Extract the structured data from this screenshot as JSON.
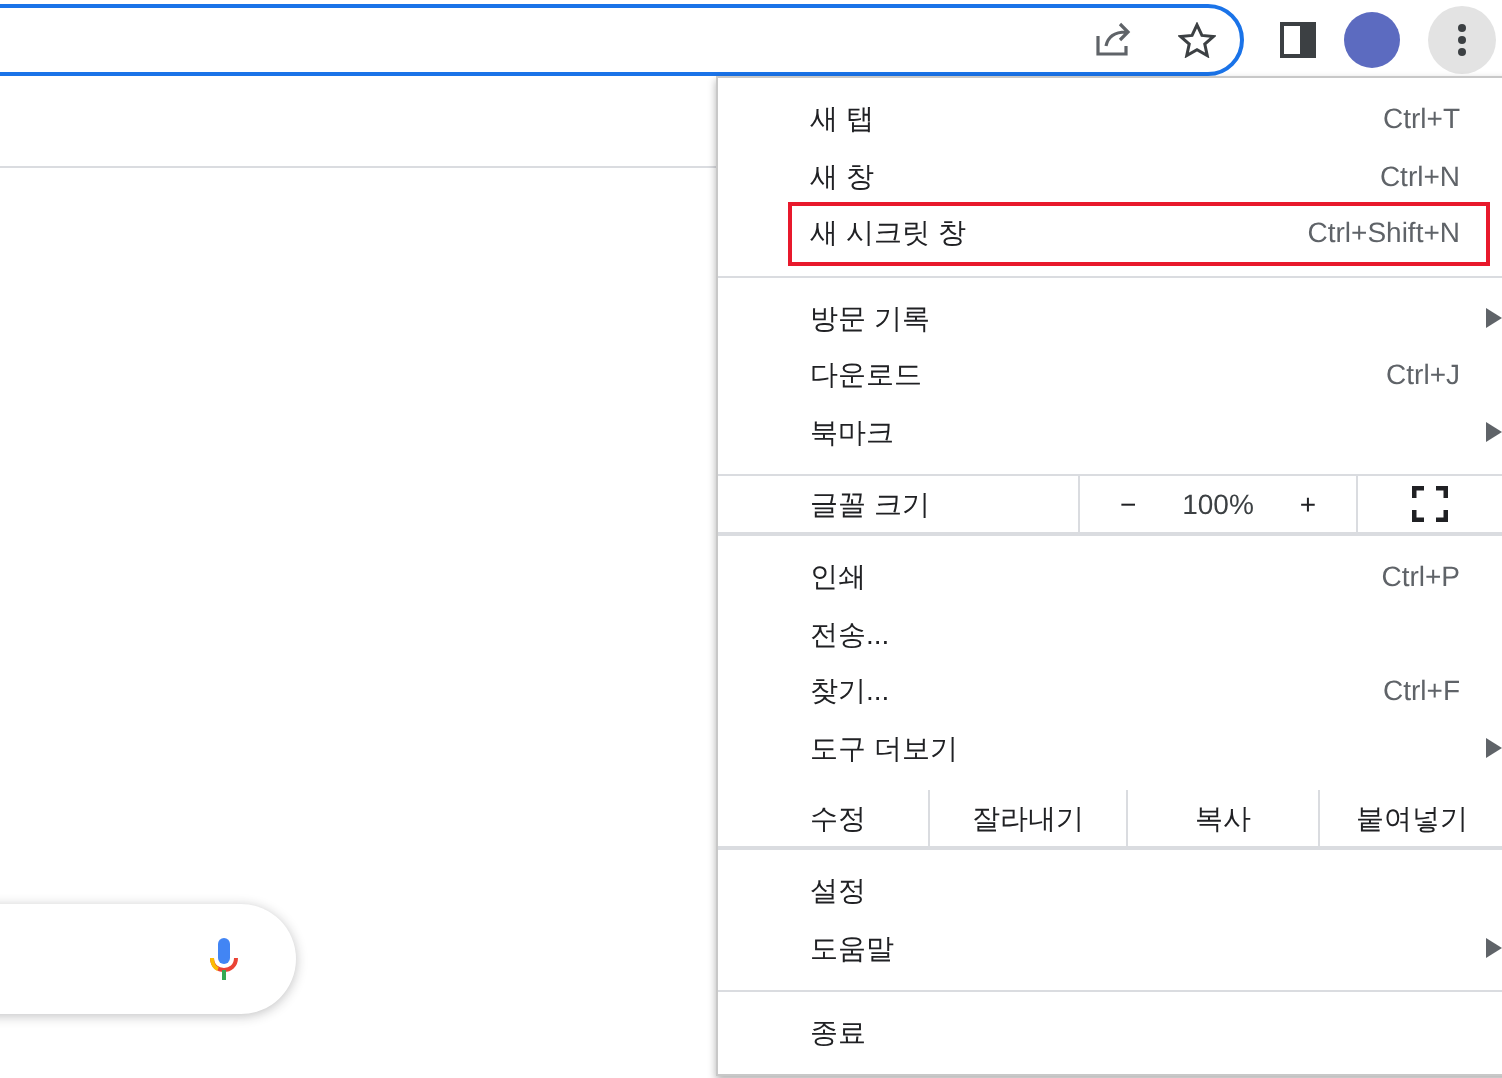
{
  "toolbar": {
    "menu_open": true
  },
  "menu": {
    "sections": [
      {
        "kind": "items",
        "items": [
          {
            "label": "새 탭",
            "shortcut": "Ctrl+T",
            "submenu": false,
            "highlighted": false
          },
          {
            "label": "새 창",
            "shortcut": "Ctrl+N",
            "submenu": false,
            "highlighted": false
          },
          {
            "label": "새 시크릿 창",
            "shortcut": "Ctrl+Shift+N",
            "submenu": false,
            "highlighted": true
          }
        ]
      },
      {
        "kind": "items",
        "items": [
          {
            "label": "방문 기록",
            "submenu": true,
            "highlighted": false
          },
          {
            "label": "다운로드",
            "shortcut": "Ctrl+J",
            "submenu": false,
            "highlighted": false
          },
          {
            "label": "북마크",
            "submenu": true,
            "highlighted": false
          }
        ]
      },
      {
        "kind": "zoom",
        "label": "글꼴 크기",
        "minus": "−",
        "value": "100%",
        "plus": "+"
      },
      {
        "kind": "items",
        "items": [
          {
            "label": "인쇄",
            "shortcut": "Ctrl+P",
            "submenu": false,
            "highlighted": false
          },
          {
            "label": "전송...",
            "submenu": false,
            "highlighted": false
          },
          {
            "label": "찾기...",
            "shortcut": "Ctrl+F",
            "submenu": false,
            "highlighted": false
          },
          {
            "label": "도구 더보기",
            "submenu": true,
            "highlighted": false
          }
        ]
      },
      {
        "kind": "edit",
        "label": "수정",
        "buttons": [
          "잘라내기",
          "복사",
          "붙여넣기"
        ]
      },
      {
        "kind": "items",
        "items": [
          {
            "label": "설정",
            "submenu": false,
            "highlighted": false
          },
          {
            "label": "도움말",
            "submenu": true,
            "highlighted": false
          }
        ]
      },
      {
        "kind": "items",
        "items": [
          {
            "label": "종료",
            "submenu": false,
            "highlighted": false
          }
        ]
      }
    ]
  }
}
